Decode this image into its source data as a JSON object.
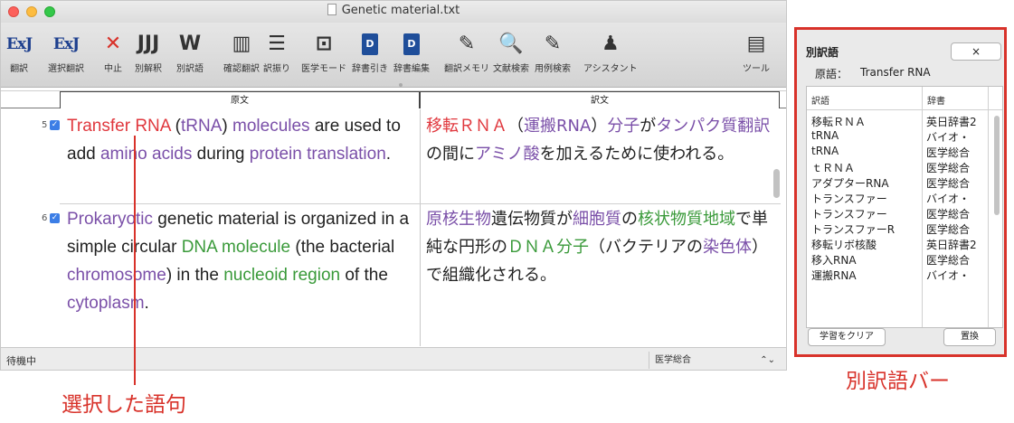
{
  "window": {
    "title": "Genetic material.txt"
  },
  "toolbar": {
    "items": [
      {
        "label": "翻訳",
        "icon": "ej-translate-icon",
        "glyph": "ExJ"
      },
      {
        "label": "選択翻訳",
        "icon": "ej-select-translate-icon",
        "glyph": "ExJ"
      },
      {
        "label": "中止",
        "icon": "stop-icon",
        "glyph": "✕"
      },
      {
        "label": "別解釈",
        "icon": "alt-interpretation-icon",
        "glyph": "JJJ"
      },
      {
        "label": "別訳語",
        "icon": "alt-translation-icon",
        "glyph": "W"
      },
      {
        "label": "確認翻訳",
        "icon": "confirm-translate-icon",
        "glyph": "▥"
      },
      {
        "label": "訳振り",
        "icon": "interlinear-icon",
        "glyph": "☰"
      },
      {
        "label": "医学モード",
        "icon": "medical-mode-icon",
        "glyph": "⊡"
      },
      {
        "label": "辞書引き",
        "icon": "dictionary-lookup-icon",
        "glyph": "D"
      },
      {
        "label": "辞書編集",
        "icon": "dictionary-edit-icon",
        "glyph": "D"
      },
      {
        "label": "翻訳メモリ",
        "icon": "translation-memory-icon",
        "glyph": "✎"
      },
      {
        "label": "文献検索",
        "icon": "literature-search-icon",
        "glyph": "🔍"
      },
      {
        "label": "用例検索",
        "icon": "example-search-icon",
        "glyph": "✎"
      },
      {
        "label": "アシスタント",
        "icon": "assistant-icon",
        "glyph": "♟"
      },
      {
        "label": "ツール",
        "icon": "tools-icon",
        "glyph": "▤"
      }
    ]
  },
  "columns": {
    "source": "原文",
    "target": "訳文"
  },
  "rows": [
    {
      "num": "5",
      "source": [
        {
          "t": "Transfer RNA",
          "c": "red"
        },
        {
          "t": " (",
          "c": ""
        },
        {
          "t": "tRNA",
          "c": "purple"
        },
        {
          "t": ") ",
          "c": ""
        },
        {
          "t": "molecules",
          "c": "purple"
        },
        {
          "t": " are used to add ",
          "c": ""
        },
        {
          "t": "amino acids",
          "c": "purple"
        },
        {
          "t": " during ",
          "c": ""
        },
        {
          "t": "protein translation",
          "c": "purple"
        },
        {
          "t": ".",
          "c": ""
        }
      ],
      "target": [
        {
          "t": "移転ＲＮＡ",
          "c": "red"
        },
        {
          "t": "（",
          "c": ""
        },
        {
          "t": "運搬RNA",
          "c": "purple"
        },
        {
          "t": "）",
          "c": ""
        },
        {
          "t": "分子",
          "c": "purple"
        },
        {
          "t": "が",
          "c": ""
        },
        {
          "t": "タンパク質翻訳",
          "c": "purple"
        },
        {
          "t": "の間に",
          "c": ""
        },
        {
          "t": "アミノ酸",
          "c": "purple"
        },
        {
          "t": "を加えるために使われる。",
          "c": ""
        }
      ]
    },
    {
      "num": "6",
      "source": [
        {
          "t": "Prokaryotic",
          "c": "purple"
        },
        {
          "t": " genetic material is organized in a simple circular ",
          "c": ""
        },
        {
          "t": "DNA molecule",
          "c": "green"
        },
        {
          "t": " (the bacterial ",
          "c": ""
        },
        {
          "t": "chromosome",
          "c": "purple"
        },
        {
          "t": ") in the ",
          "c": ""
        },
        {
          "t": "nucleoid region",
          "c": "green"
        },
        {
          "t": " of the ",
          "c": ""
        },
        {
          "t": "cytoplasm",
          "c": "purple"
        },
        {
          "t": ".",
          "c": ""
        }
      ],
      "target": [
        {
          "t": "原核生物",
          "c": "purple"
        },
        {
          "t": "遺伝物質が",
          "c": ""
        },
        {
          "t": "細胞質",
          "c": "purple"
        },
        {
          "t": "の",
          "c": ""
        },
        {
          "t": "核状物質地域",
          "c": "green"
        },
        {
          "t": "で単純な円形の",
          "c": ""
        },
        {
          "t": "ＤＮＡ分子",
          "c": "green"
        },
        {
          "t": "（バクテリアの",
          "c": ""
        },
        {
          "t": "染色体",
          "c": "purple"
        },
        {
          "t": "）で組織化される。",
          "c": ""
        }
      ]
    }
  ],
  "status": {
    "text": "待機中",
    "dictionary": "医学総合"
  },
  "alt_panel": {
    "title": "別訳語",
    "close_label": "×",
    "source_label": "原語：",
    "source_term": "Transfer RNA",
    "columns": {
      "term": "訳語",
      "dict": "辞書"
    },
    "rows": [
      {
        "term": "移転ＲＮＡ",
        "dict": "英日辞書2"
      },
      {
        "term": "tRNA",
        "dict": "バイオ・"
      },
      {
        "term": "tRNA",
        "dict": "医学総合"
      },
      {
        "term": "ｔＲＮＡ",
        "dict": "医学総合"
      },
      {
        "term": "アダプターRNA",
        "dict": "医学総合"
      },
      {
        "term": "トランスファー",
        "dict": "バイオ・"
      },
      {
        "term": "トランスファー",
        "dict": "医学総合"
      },
      {
        "term": "トランスファーR",
        "dict": "医学総合"
      },
      {
        "term": "移転リボ核酸",
        "dict": "英日辞書2"
      },
      {
        "term": "移入RNA",
        "dict": "医学総合"
      },
      {
        "term": "運搬RNA",
        "dict": "バイオ・"
      }
    ],
    "clear_label": "学習をクリア",
    "replace_label": "置換"
  },
  "annotations": {
    "selected": "選択した語句",
    "alt_bar": "別訳語バー"
  },
  "colors": {
    "accent_red": "#d8322a",
    "term_red": "#e0383e",
    "term_purple": "#7a4fa8",
    "term_green": "#3a9a3a"
  }
}
